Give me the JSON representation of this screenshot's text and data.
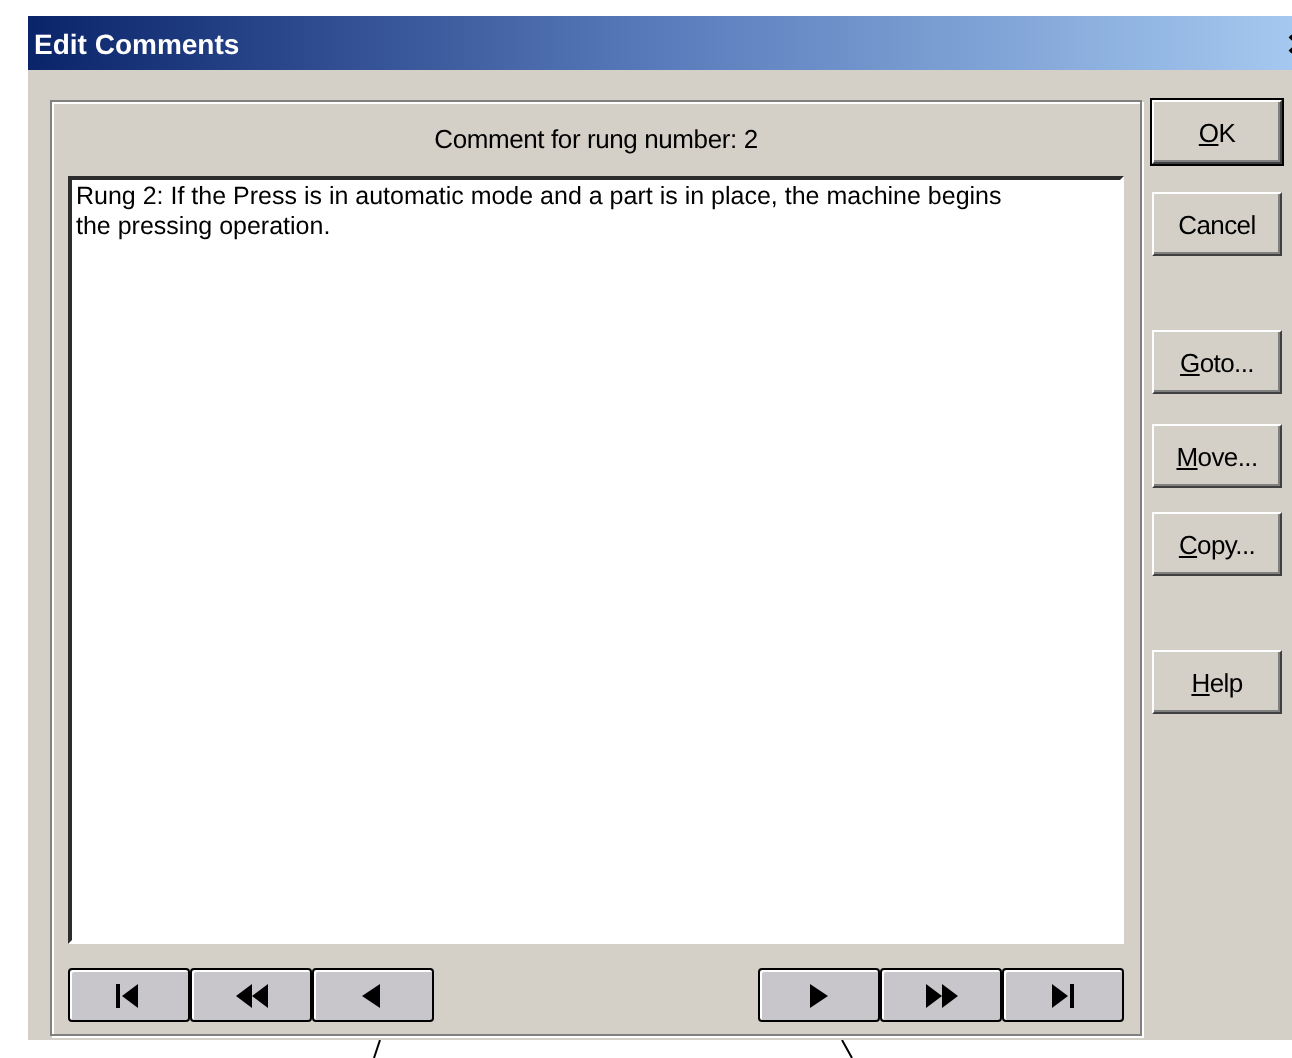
{
  "window": {
    "title": "Edit Comments"
  },
  "comment": {
    "label": "Comment for rung number: 2",
    "value": "Rung 2: If the Press is in automatic mode and a part is in place, the machine begins\nthe pressing operation."
  },
  "nav_buttons": [
    {
      "kind": "first"
    },
    {
      "kind": "rewind"
    },
    {
      "kind": "previous"
    },
    {
      "kind": "next"
    },
    {
      "kind": "forward"
    },
    {
      "kind": "last"
    }
  ],
  "side_buttons": [
    {
      "accel": "O",
      "rest": "K",
      "default": true
    },
    {
      "rest": "Cancel",
      "default": false
    },
    {
      "accel": "G",
      "rest": "oto...",
      "default": false
    },
    {
      "accel": "M",
      "rest": "ove...",
      "default": false
    },
    {
      "accel": "C",
      "rest": "opy...",
      "default": false
    },
    {
      "accel": "H",
      "rest": "elp",
      "default": false
    }
  ]
}
